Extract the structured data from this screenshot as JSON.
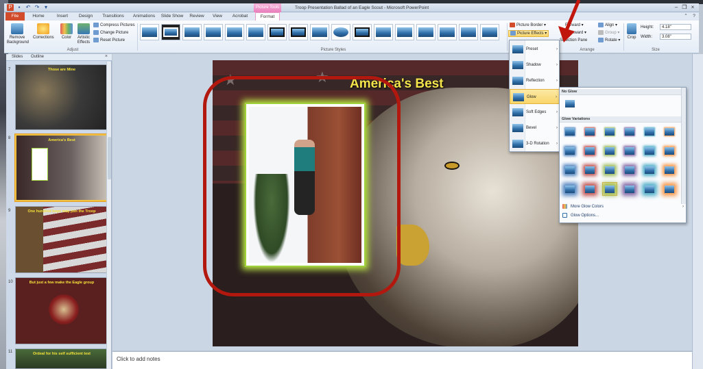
{
  "window": {
    "title": "Troop Presentation Ballad of an Eagle Scout - Microsoft PowerPoint",
    "contextual_tab_group": "Picture Tools",
    "qat_icons": [
      "powerpoint-logo-icon",
      "save-icon",
      "undo-icon",
      "redo-icon",
      "customize-qat-icon"
    ],
    "controls": [
      "minimize-icon",
      "restore-icon",
      "close-icon"
    ]
  },
  "ribbon_tabs": [
    "File",
    "Home",
    "Insert",
    "Design",
    "Transitions",
    "Animations",
    "Slide Show",
    "Review",
    "View",
    "Acrobat",
    "Format"
  ],
  "ribbon": {
    "adjust": {
      "remove_background": "Remove Background",
      "corrections": "Corrections",
      "color": "Color",
      "artistic_effects": "Artistic Effects",
      "compress": "Compress Pictures",
      "change": "Change Picture",
      "reset": "Reset Picture",
      "label": "Adjust"
    },
    "picture_styles": {
      "label": "Picture Styles",
      "border": "Picture Border",
      "effects": "Picture Effects",
      "thumb_count": 17
    },
    "arrange": {
      "forward": "Forward",
      "backward": "Backward",
      "selection_pane": "Selection Pane",
      "align": "Align",
      "group": "Group",
      "rotate": "Rotate",
      "label": "Arrange"
    },
    "size": {
      "crop": "Crop",
      "height_label": "Height:",
      "height_value": "4.18\"",
      "width_label": "Width:",
      "width_value": "3.08\"",
      "label": "Size"
    }
  },
  "left_pane": {
    "tabs": [
      "Slides",
      "Outline"
    ],
    "close": "×",
    "slides": [
      {
        "num": "7",
        "title": "Those are Mine"
      },
      {
        "num": "8",
        "title": "America's Best"
      },
      {
        "num": "9",
        "title": "One hundred boys may join the Troop"
      },
      {
        "num": "10",
        "title": "But just a few make the Eagle group"
      },
      {
        "num": "11",
        "title": "Ordeal for his self sufficient test"
      }
    ]
  },
  "slide": {
    "title": "America's Best"
  },
  "notes": {
    "placeholder": "Click to add notes"
  },
  "effects_menu": {
    "items": [
      "Preset",
      "Shadow",
      "Reflection",
      "Glow",
      "Soft Edges",
      "Bevel",
      "3-D Rotation"
    ],
    "active": "Glow"
  },
  "glow_gallery": {
    "no_glow_header": "No Glow",
    "variations_header": "Glow Variations",
    "more_colors": "More Glow Colors",
    "options": "Glow Options...",
    "row_colors": [
      "#4f81bd",
      "#c0504d",
      "#9bbb59",
      "#8064a2",
      "#4bacc6",
      "#f79646"
    ],
    "selected_row": 3,
    "selected_col": 2
  }
}
